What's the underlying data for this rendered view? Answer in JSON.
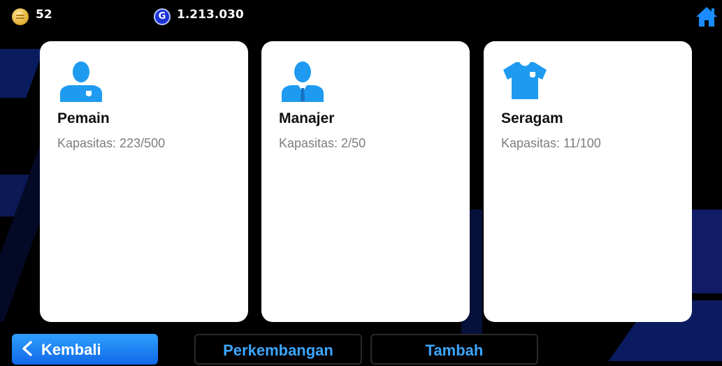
{
  "currency": {
    "coins": "52",
    "gp": "1.213.030",
    "gp_icon_letter": "G"
  },
  "cards": [
    {
      "title": "Pemain",
      "capacity": "Kapasitas: 223/500",
      "icon": "player-icon"
    },
    {
      "title": "Manajer",
      "capacity": "Kapasitas: 2/50",
      "icon": "manager-icon"
    },
    {
      "title": "Seragam",
      "capacity": "Kapasitas: 11/100",
      "icon": "kit-icon"
    }
  ],
  "buttons": {
    "back": "Kembali",
    "develop": "Perkembangan",
    "add": "Tambah"
  },
  "colors": {
    "accent": "#1b8cff",
    "icon_blue": "#1e9bf0",
    "card_bg": "#ffffff",
    "background": "#000000"
  }
}
